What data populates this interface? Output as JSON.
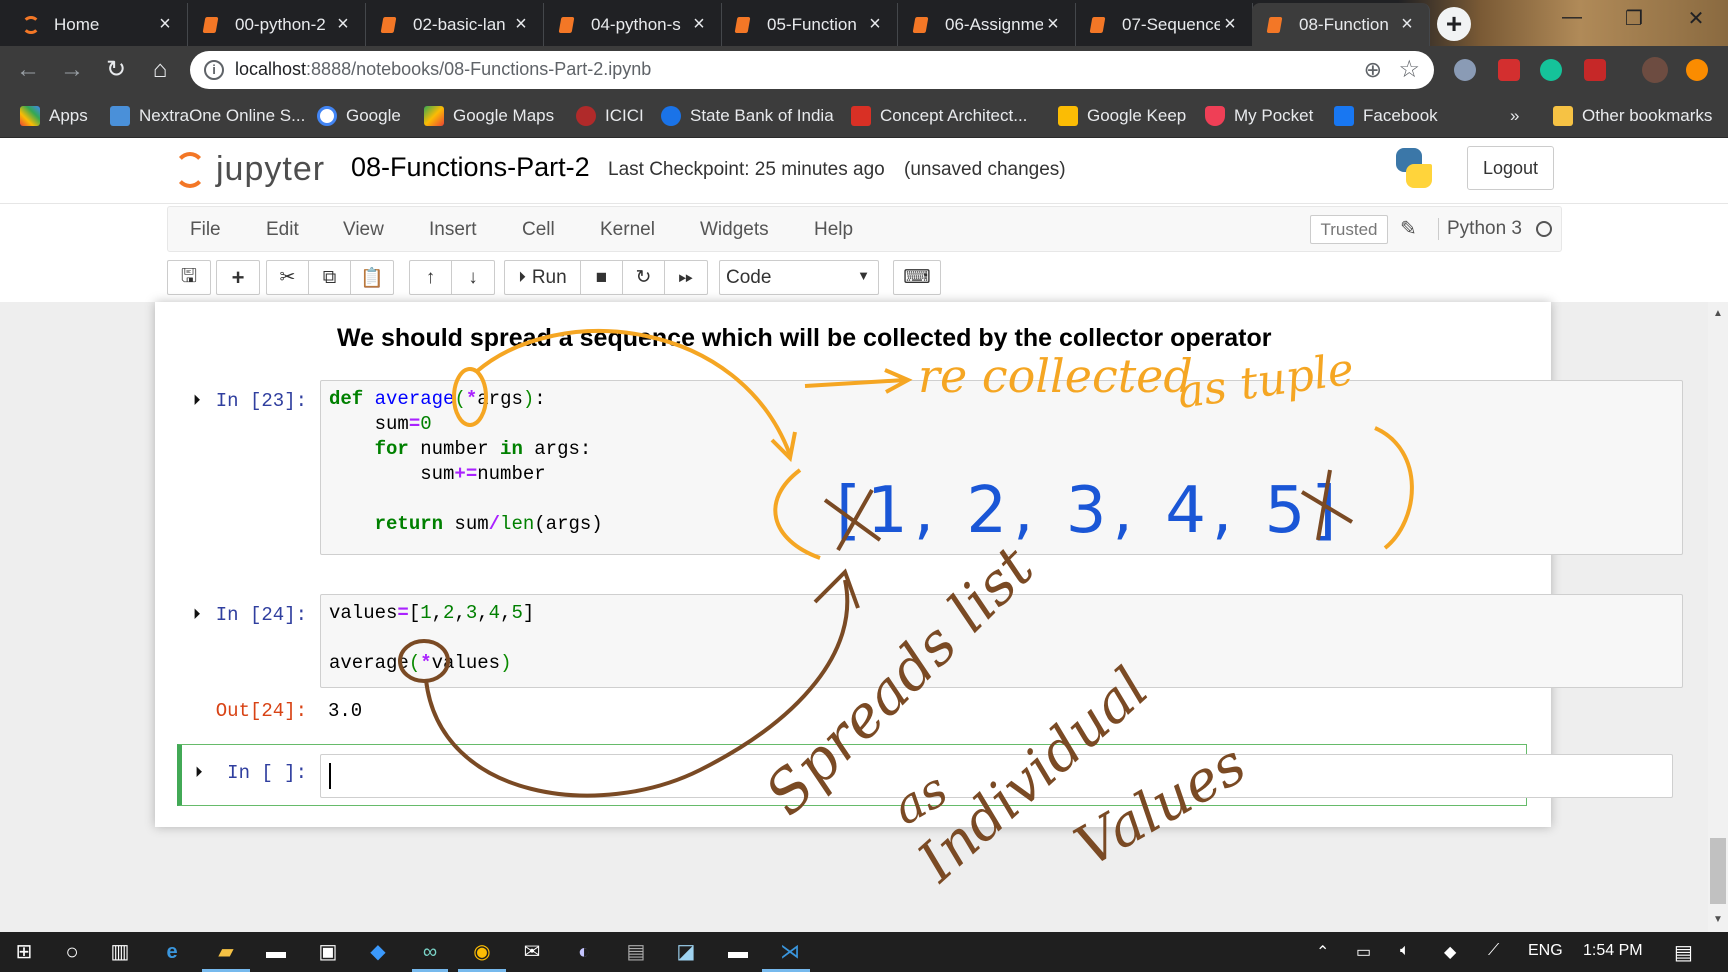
{
  "browser": {
    "tabs": [
      {
        "label": "Home",
        "icon": "jupyter-home-icon",
        "active": false
      },
      {
        "label": "00-python-2",
        "icon": "notebook-icon",
        "active": false
      },
      {
        "label": "02-basic-lan",
        "icon": "notebook-icon",
        "active": false
      },
      {
        "label": "04-python-s",
        "icon": "notebook-icon",
        "active": false
      },
      {
        "label": "05-Function",
        "icon": "notebook-icon",
        "active": false
      },
      {
        "label": "06-Assignme",
        "icon": "notebook-icon",
        "active": false
      },
      {
        "label": "07-Sequence",
        "icon": "notebook-icon",
        "active": false
      },
      {
        "label": "08-Function",
        "icon": "notebook-icon",
        "active": true
      }
    ],
    "close_glyph": "×",
    "new_tab_glyph": "+",
    "url_host": "localhost",
    "url_path": ":8888/notebooks/08-Functions-Part-2.ipynb",
    "bookmarks": [
      {
        "label": "Apps",
        "color": "#ea4335"
      },
      {
        "label": "NextraOne Online S...",
        "color": "#4a90d9"
      },
      {
        "label": "Google",
        "color": "#4285f4"
      },
      {
        "label": "Google Maps",
        "color": "#34a853"
      },
      {
        "label": "ICICI",
        "color": "#b02a2a"
      },
      {
        "label": "State Bank of India",
        "color": "#1a73e8"
      },
      {
        "label": "Concept Architect...",
        "color": "#d93025"
      },
      {
        "label": "Google Keep",
        "color": "#fbbc04"
      },
      {
        "label": "My Pocket",
        "color": "#ef3f56"
      },
      {
        "label": "Facebook",
        "color": "#1877f2"
      }
    ],
    "more_bookmarks": "»",
    "other_bookmarks": "Other bookmarks"
  },
  "jupyter": {
    "logo_text": "jupyter",
    "notebook_name": "08-Functions-Part-2",
    "checkpoint": "Last Checkpoint: 25 minutes ago",
    "unsaved": "(unsaved changes)",
    "logout": "Logout",
    "menu": [
      "File",
      "Edit",
      "View",
      "Insert",
      "Cell",
      "Kernel",
      "Widgets",
      "Help"
    ],
    "trusted": "Trusted",
    "kernel": "Python 3",
    "run_label": "Run",
    "cell_type": "Code"
  },
  "notebook": {
    "heading": "We should spread a sequence which will be collected by the collector operator",
    "cells": [
      {
        "prompt": "In [23]:"
      },
      {
        "prompt": "In [24]:",
        "out_prompt": "Out[24]:",
        "output": "3.0"
      },
      {
        "prompt": "In [ ]:"
      }
    ]
  },
  "annotations": {
    "orange_note_1": "re collected",
    "orange_note_2": "as tuple",
    "list_sketch": "[1, 2, 3, 4, 5]",
    "brown_note_1": "Spreads list",
    "brown_note_2": "as",
    "brown_note_3": "Individual",
    "brown_note_4": "Values"
  },
  "taskbar": {
    "language": "ENG",
    "time": "1:54 PM"
  },
  "colors": {
    "orange_ink": "#f5a623",
    "blue_ink": "#1a56d6",
    "brown_ink": "#7a4a24",
    "jupyter_orange": "#f37726",
    "selected_cell": "#42a956"
  }
}
